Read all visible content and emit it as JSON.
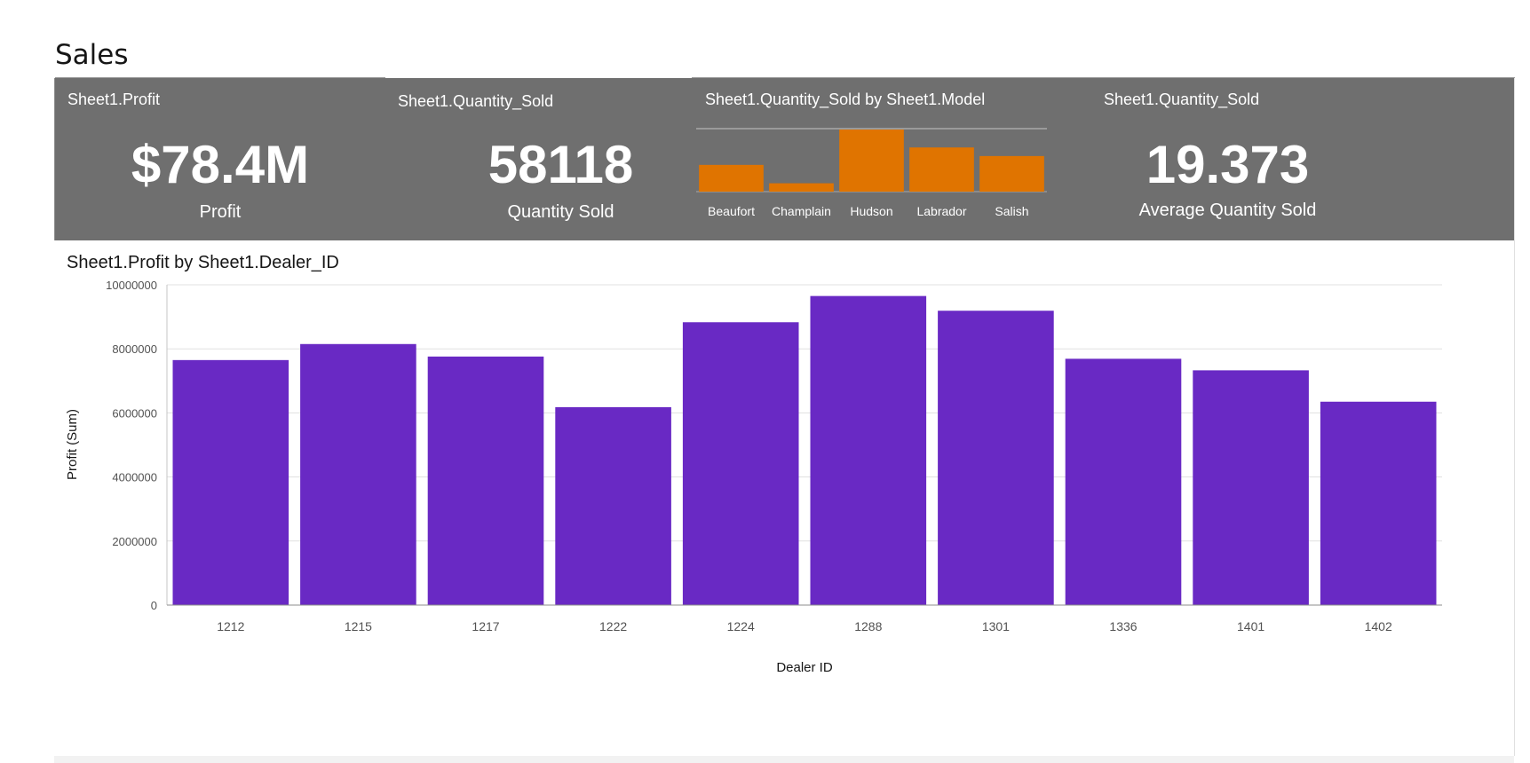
{
  "page": {
    "title": "Sales"
  },
  "tiles": [
    {
      "title": "Sheet1.Profit",
      "value": "$78.4M",
      "label": "Profit"
    },
    {
      "title": "Sheet1.Quantity_Sold",
      "value": "58118",
      "label": "Quantity Sold"
    },
    {
      "title": "Sheet1.Quantity_Sold by Sheet1.Model"
    },
    {
      "title": "Sheet1.Quantity_Sold",
      "value": "19.373",
      "label": "Average Quantity Sold"
    }
  ],
  "main": {
    "title": "Sheet1.Profit by Sheet1.Dealer_ID"
  },
  "colors": {
    "kpi_background": "#6f6f6f",
    "mini_bar": "#e07400",
    "main_bar": "#6929c4"
  },
  "chart_data": [
    {
      "type": "bar",
      "title": "Sheet1.Quantity_Sold by Sheet1.Model",
      "categories": [
        "Beaufort",
        "Champlain",
        "Hudson",
        "Labrador",
        "Salish"
      ],
      "values": [
        11500,
        3600,
        26700,
        19000,
        15300
      ],
      "ylim": [
        0,
        26700
      ]
    },
    {
      "type": "bar",
      "title": "Sheet1.Profit by Sheet1.Dealer_ID",
      "xlabel": "Dealer ID",
      "ylabel": "Profit (Sum)",
      "categories": [
        "1212",
        "1215",
        "1217",
        "1222",
        "1224",
        "1288",
        "1301",
        "1336",
        "1401",
        "1402"
      ],
      "values": [
        7650000,
        8150000,
        7760000,
        6180000,
        8830000,
        9650000,
        9190000,
        7690000,
        7330000,
        6350000
      ],
      "yticks": [
        "0",
        "2000000",
        "4000000",
        "6000000",
        "8000000",
        "10000000"
      ],
      "ylim": [
        0,
        10000000
      ],
      "grid": true
    }
  ]
}
